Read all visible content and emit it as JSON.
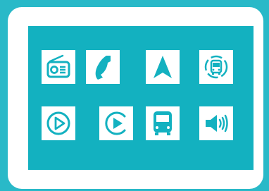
{
  "colors": {
    "background": "#29b9c8",
    "bezel": "#ffffff",
    "screen": "#13b1c0",
    "tile": "#ffffff",
    "icon": "#13b1c0"
  },
  "tiles": [
    {
      "icon": "radio-icon"
    },
    {
      "icon": "phone-icon"
    },
    {
      "icon": "navigation-arrow-icon"
    },
    {
      "icon": "bus-stop-icon"
    },
    {
      "icon": "play-circle-icon"
    },
    {
      "icon": "play-circle-alt-icon"
    },
    {
      "icon": "bus-icon"
    },
    {
      "icon": "speaker-volume-icon"
    }
  ]
}
